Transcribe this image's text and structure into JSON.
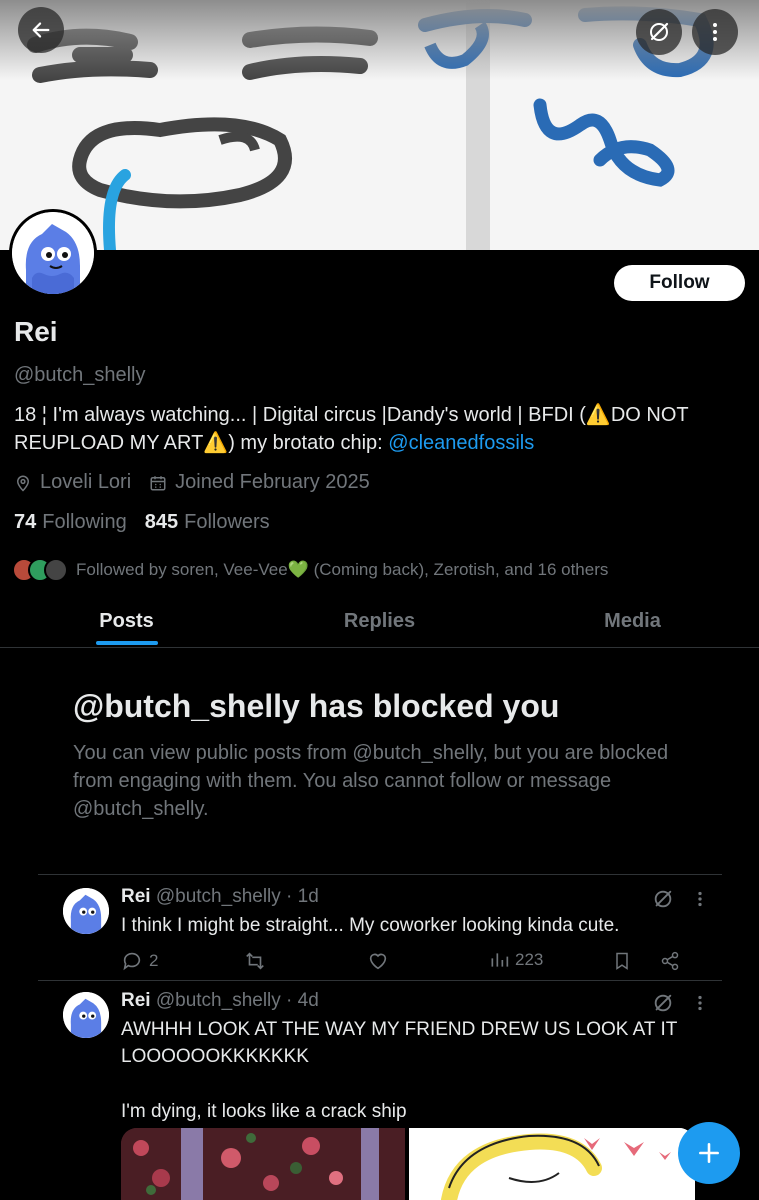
{
  "header": {
    "back_icon": "arrow-left-icon",
    "grok_icon": "slash-circle-icon",
    "more_icon": "more-vertical-icon"
  },
  "profile": {
    "follow_label": "Follow",
    "display_name": "Rei",
    "handle": "@butch_shelly",
    "bio_text": "18 ¦ I'm always watching... | Digital circus |Dandy's world | BFDI (⚠️DO NOT REUPLOAD MY ART⚠️) my brotato chip: ",
    "bio_link": "@cleanedfossils",
    "location": "Loveli Lori",
    "joined": "Joined February 2025",
    "following_count": "74",
    "following_label": "Following",
    "followers_count": "845",
    "followers_label": "Followers",
    "followed_by": "Followed by soren, Vee-Vee💚 (Coming back), Zerotish, and 16 others"
  },
  "tabs": [
    {
      "label": "Posts",
      "active": true
    },
    {
      "label": "Replies",
      "active": false
    },
    {
      "label": "Media",
      "active": false
    }
  ],
  "blocked": {
    "title": "@butch_shelly has blocked you",
    "text": "You can view public posts from @butch_shelly, but you are blocked from engaging with them. You also cannot follow or message @butch_shelly."
  },
  "posts": [
    {
      "name": "Rei",
      "meta": "@butch_shelly · 1d",
      "text": "I think I might be straight... My coworker looking kinda cute.",
      "replies": "2",
      "views": "223"
    },
    {
      "name": "Rei",
      "meta": "@butch_shelly · 4d",
      "text_1": "AWHHH LOOK AT THE WAY MY FRIEND DREW US LOOK AT IT LOOOOOOKKKKKKK",
      "text_2": "I'm dying, it looks like a crack ship"
    }
  ],
  "colors": {
    "accent": "#1d9bf0",
    "background": "#000000",
    "text_primary": "#e7e9ea",
    "text_secondary": "#71767b",
    "avatar_blue": "#5b7ee6"
  }
}
